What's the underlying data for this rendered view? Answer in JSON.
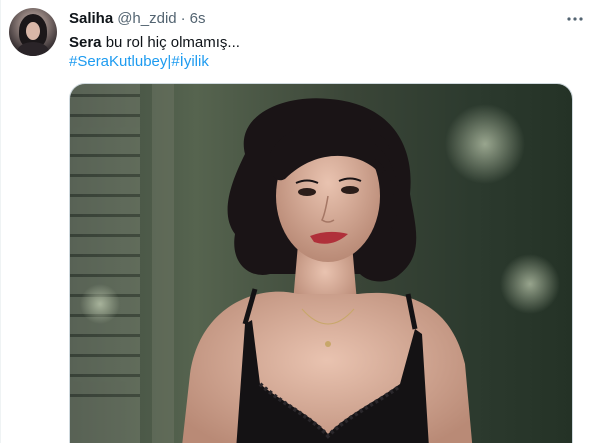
{
  "author": {
    "display_name": "Saliha",
    "handle": "@h_zdid",
    "separator": "·",
    "time": "6s"
  },
  "tweet": {
    "text_bold": "Sera",
    "text_rest": " bu rol hiç olmamış...",
    "hashtag_1": "#SeraKutlubey",
    "hashtag_sep": "|",
    "hashtag_2": "#İyilik"
  },
  "icons": {
    "more": "more-horizontal-icon"
  },
  "colors": {
    "link": "#1d9bf0",
    "secondary_text": "#536471",
    "primary_text": "#0f1419"
  }
}
